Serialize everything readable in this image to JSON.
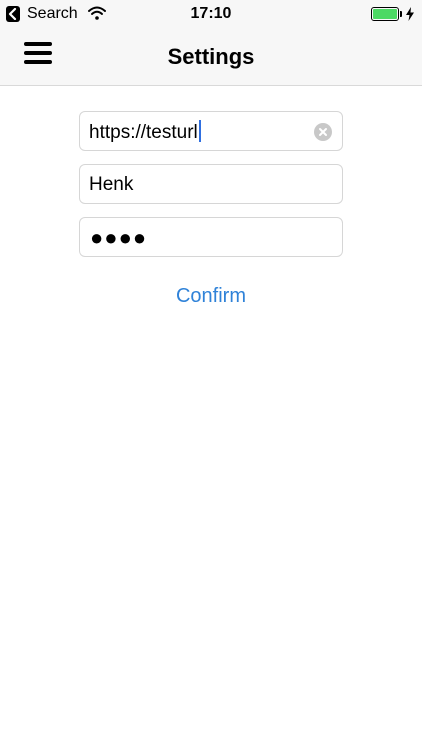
{
  "status_bar": {
    "back_label": "Search",
    "time": "17:10",
    "battery_color": "#4cd964"
  },
  "nav": {
    "title": "Settings",
    "menu_icon": "hamburger-menu-icon"
  },
  "form": {
    "url_value": "https://testurl",
    "username_value": "Henk",
    "password_masked": "●●●●"
  },
  "actions": {
    "confirm_label": "Confirm",
    "accent_color": "#2f82d8"
  }
}
